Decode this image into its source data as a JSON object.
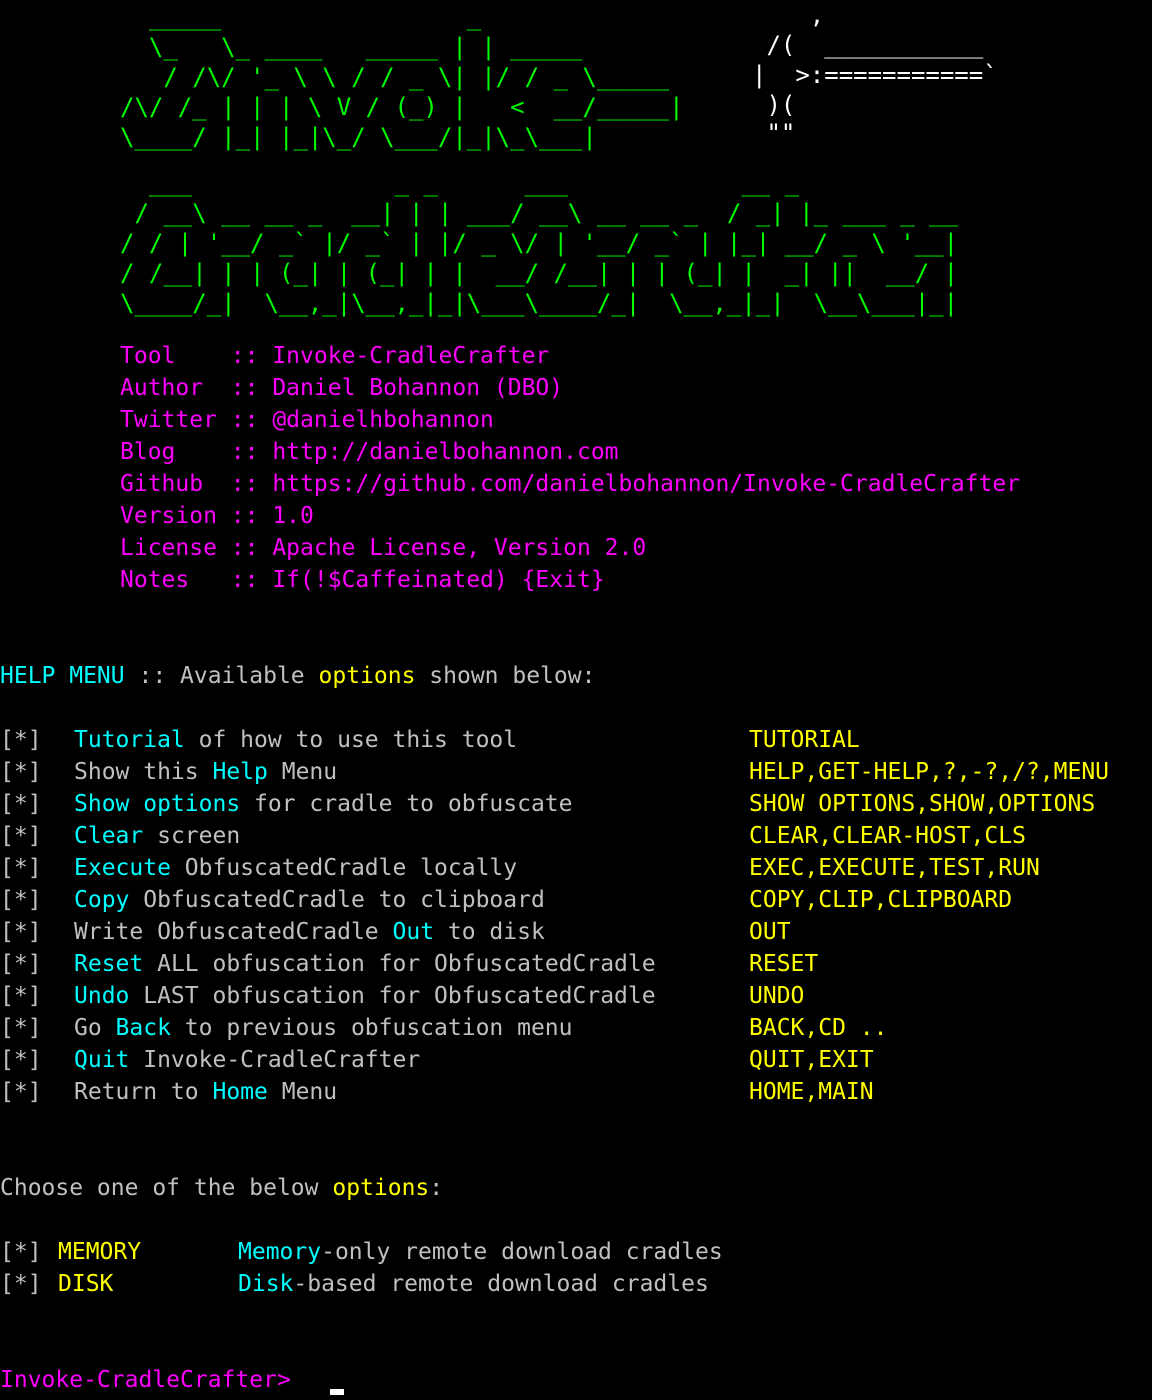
{
  "banner": {
    "logo_lines": [
      "  _____                 _",
      "  \\_   \\_ ____   _____ | | _____",
      "   / /\\/ '_ \\ \\ / / _ \\| |/ / _ \\_____",
      "/\\/ /_ | | | \\ V / (_) |   <  __/_____|",
      "\\____/ |_| |_|\\_/ \\___/|_|\\_\\___|",
      "  ___              _ _      ___            __ _",
      " / __\\ __ __ _  __| | | ___/ __\\ __ __ _  / _| |_ ___ _ __",
      "/ / | '__/ _` |/ _` | |/ _ \\/ | '__/ _` | |_| __/ _ \\ '__|",
      "/ /__| | | (_| | (_| | |  __/ /__| | | (_| |  _| ||  __/ |",
      "\\____/_|  \\__,_|\\__,_|_|\\___\\____/_|  \\__,_|_|  \\__\\___|_|"
    ],
    "art_lines": [
      "    ,",
      " /(  ___________",
      "|  >:===========`",
      " )(",
      " \"\""
    ]
  },
  "info": [
    {
      "key": "Tool    ",
      "sep": ":: ",
      "value": "Invoke-CradleCrafter"
    },
    {
      "key": "Author  ",
      "sep": ":: ",
      "value": "Daniel Bohannon (DBO)"
    },
    {
      "key": "Twitter ",
      "sep": ":: ",
      "value": "@danielhbohannon"
    },
    {
      "key": "Blog    ",
      "sep": ":: ",
      "value": "http://danielbohannon.com"
    },
    {
      "key": "Github  ",
      "sep": ":: ",
      "value": "https://github.com/danielbohannon/Invoke-CradleCrafter"
    },
    {
      "key": "Version ",
      "sep": ":: ",
      "value": "1.0"
    },
    {
      "key": "License ",
      "sep": ":: ",
      "value": "Apache License, Version 2.0"
    },
    {
      "key": "Notes   ",
      "sep": ":: ",
      "value": "If(!$Caffeinated) {Exit}"
    }
  ],
  "help_header": {
    "p1": "HELP MENU",
    "p2": " :: Available ",
    "p3": "options",
    "p4": " shown below:"
  },
  "menu_items": [
    {
      "bracket": "[*]",
      "pre": "",
      "hl": "Tutorial",
      "post": " of how to use this tool",
      "cmd": "TUTORIAL"
    },
    {
      "bracket": "[*]",
      "pre": "Show this ",
      "hl": "Help",
      "post": " Menu",
      "cmd": "HELP,GET-HELP,?,-?,/?,MENU"
    },
    {
      "bracket": "[*]",
      "pre": "",
      "hl": "Show options",
      "post": " for cradle to obfuscate",
      "cmd": "SHOW OPTIONS,SHOW,OPTIONS"
    },
    {
      "bracket": "[*]",
      "pre": "",
      "hl": "Clear",
      "post": " screen",
      "cmd": "CLEAR,CLEAR-HOST,CLS"
    },
    {
      "bracket": "[*]",
      "pre": "",
      "hl": "Execute",
      "post": " ObfuscatedCradle locally",
      "cmd": "EXEC,EXECUTE,TEST,RUN"
    },
    {
      "bracket": "[*]",
      "pre": "",
      "hl": "Copy",
      "post": " ObfuscatedCradle to clipboard",
      "cmd": "COPY,CLIP,CLIPBOARD"
    },
    {
      "bracket": "[*]",
      "pre": "Write ObfuscatedCradle ",
      "hl": "Out",
      "post": " to disk",
      "cmd": "OUT"
    },
    {
      "bracket": "[*]",
      "pre": "",
      "hl": "Reset",
      "post": " ALL obfuscation for ObfuscatedCradle",
      "cmd": "RESET"
    },
    {
      "bracket": "[*]",
      "pre": "",
      "hl": "Undo",
      "post": " LAST obfuscation for ObfuscatedCradle",
      "cmd": "UNDO"
    },
    {
      "bracket": "[*]",
      "pre": "Go ",
      "hl": "Back",
      "post": " to previous obfuscation menu",
      "cmd": "BACK,CD .."
    },
    {
      "bracket": "[*]",
      "pre": "",
      "hl": "Quit",
      "post": " Invoke-CradleCrafter",
      "cmd": "QUIT,EXIT"
    },
    {
      "bracket": "[*]",
      "pre": "Return to ",
      "hl": "Home",
      "post": " Menu",
      "cmd": "HOME,MAIN"
    }
  ],
  "choose_header": {
    "p1": "Choose one of the below ",
    "p2": "options",
    "p3": ":"
  },
  "options": [
    {
      "bracket": "[*]",
      "name": "MEMORY",
      "hl": "Memory",
      "desc": "-only remote download cradles"
    },
    {
      "bracket": "[*]",
      "name": "DISK",
      "hl": "Disk",
      "desc": "-based remote download cradles"
    }
  ],
  "prompt": {
    "text": "Invoke-CradleCrafter>",
    "input_value": ""
  },
  "colors": {
    "background": "#000000",
    "logo": "#00ff00",
    "info": "#ff00ff",
    "highlight": "#00ffff",
    "command": "#ffff00",
    "text": "#c0c0c0"
  }
}
